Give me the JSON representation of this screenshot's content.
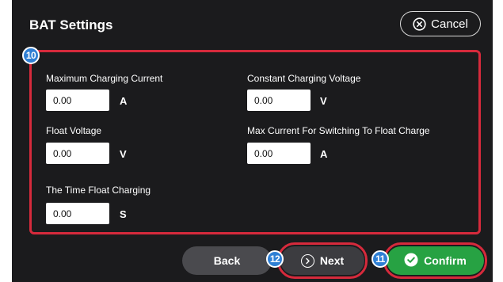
{
  "header": {
    "title": "BAT Settings",
    "cancel_label": "Cancel",
    "cancel_icon": "circle-x-icon"
  },
  "markers": {
    "panel": "10",
    "confirm": "11",
    "next": "12"
  },
  "fields": {
    "max_charging_current": {
      "label": "Maximum Charging Current",
      "value": "0.00",
      "unit": "A"
    },
    "constant_charging_voltage": {
      "label": "Constant Charging Voltage",
      "value": "0.00",
      "unit": "V"
    },
    "float_voltage": {
      "label": "Float Voltage",
      "value": "0.00",
      "unit": "V"
    },
    "max_current_switch_float": {
      "label": "Max Current For Switching To Float Charge",
      "value": "0.00",
      "unit": "A"
    },
    "time_float_charging": {
      "label": "The Time Float Charging",
      "value": "0.00",
      "unit": "S"
    }
  },
  "footer": {
    "back_label": "Back",
    "next_label": "Next",
    "next_icon": "circle-chevron-right-icon",
    "confirm_label": "Confirm",
    "confirm_icon": "circle-check-icon"
  },
  "colors": {
    "background": "#1b1b1d",
    "highlight": "#d62a3c",
    "marker": "#2f7fd4",
    "confirm": "#27a243",
    "back": "#4a4a4e"
  }
}
